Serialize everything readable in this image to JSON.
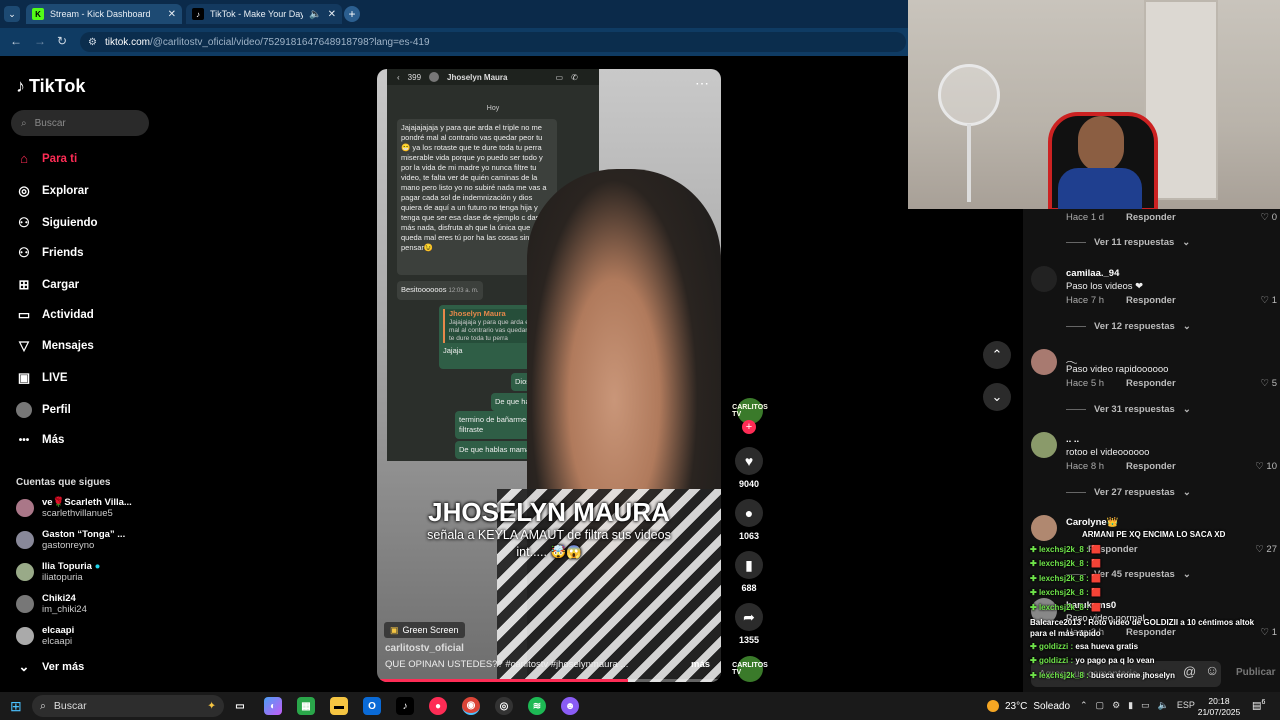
{
  "browser": {
    "tabs": [
      {
        "title": "Stream - Kick Dashboard",
        "favicon": "K"
      },
      {
        "title": "TikTok - Make Your Day",
        "favicon": "♪"
      }
    ],
    "url_host": "tiktok.com",
    "url_path": "/@carlitostv_oficial/video/7529181647648918798?lang=es-419"
  },
  "tiktok": {
    "logo": "TikTok",
    "search_placeholder": "Buscar",
    "nav": [
      {
        "label": "Para ti",
        "icon": "⌂"
      },
      {
        "label": "Explorar",
        "icon": "◎"
      },
      {
        "label": "Siguiendo",
        "icon": "⚇"
      },
      {
        "label": "Friends",
        "icon": "⚇"
      },
      {
        "label": "Cargar",
        "icon": "⊞"
      },
      {
        "label": "Actividad",
        "icon": "▭"
      },
      {
        "label": "Mensajes",
        "icon": "▽"
      },
      {
        "label": "LIVE",
        "icon": "▣"
      },
      {
        "label": "Perfil",
        "icon": ""
      },
      {
        "label": "Más",
        "icon": "•••"
      }
    ],
    "following_header": "Cuentas que sigues",
    "accounts": [
      {
        "name": "ve🌹Scarleth Villa...",
        "user": "scarlethvillanue5"
      },
      {
        "name": "Gaston “Tonga” ...",
        "user": "gastonreyno"
      },
      {
        "name": "Ilia Topuria",
        "user": "iliatopuria"
      },
      {
        "name": "Chiki24",
        "user": "im_chiki24"
      },
      {
        "name": "elcaapi",
        "user": "elcaapi"
      }
    ],
    "see_more": "Ver más"
  },
  "video": {
    "chat_back_count": "399",
    "chat_contact": "Jhoselyn Maura",
    "chat_day": "Hoy",
    "chat_msg_main": "Jajajajajaja y para que arda el triple no me pondré mal al contrario vas quedar peor tu 😁 ya los rotaste que te dure toda tu perra miserable vida porque yo puedo ser todo y por la vida de mi madre yo nunca filtre tu video, te falta ver de quién caminas de la mano pero listo yo no subiré nada me vas a pagar cada sol de indemnización y dios quiera de aquí a un futuro no tenga hija y tenga que ser esa clase de ejemplo c das tu, más nada, disfruta ah que la única que queda mal eres tú por ha las cosas sin pensar😉",
    "chat_msg_besito": "Besitoooooos",
    "chat_time": "12:03 a. m.",
    "chat_quote_name": "Jhoselyn Maura",
    "chat_quote_text": "Jajajajaja y para que arda el triple no me pondré mal al contrario vas quedar peor tu los rotaste que te dure toda tu perra",
    "chat_reply_1": "Jajaja",
    "chat_reply_2": "Dios mio",
    "chat_reply_3": "De que hablas",
    "chat_reply_4": "termino de bañarme y tu filtraste",
    "chat_reply_5": "De que hablas mama",
    "caption_big": "JHOSELYN MAURA",
    "caption_sub": "señala a KEYLA AMAUT de filtra sus videos int..... 🤯😱",
    "badge": "Green Screen",
    "username": "carlitostv_oficial",
    "description": "QUE OPINAN USTEDES?? #carlitostv #jhoselynmaura ...",
    "more": "más",
    "progress": 0.73,
    "likes": "9040",
    "comments": "1063",
    "saves": "688",
    "shares": "1355",
    "creator_badge": "CARLITOS TV"
  },
  "comments": [
    {
      "meta_time": "Hace 1 d",
      "reply": "Responder",
      "likes": "0",
      "replies": "Ver 11 respuestas"
    },
    {
      "user": "camilaa._94",
      "text": "Paso los videos ❤",
      "meta_time": "Hace 7 h",
      "reply": "Responder",
      "likes": "1",
      "replies": "Ver 12 respuestas"
    },
    {
      "user": "𓂃",
      "text": "Paso video rapidoooooo",
      "meta_time": "Hace 5 h",
      "reply": "Responder",
      "likes": "5",
      "replies": "Ver 31 respuestas"
    },
    {
      "user": ".. ..",
      "text": "rotoo el videoooooo",
      "meta_time": "Hace 8 h",
      "reply": "Responder",
      "likes": "10",
      "replies": "Ver 27 respuestas"
    },
    {
      "user": "Carolyne👑",
      "text": "",
      "meta_time": "",
      "reply": "Responder",
      "likes": "27",
      "replies": "Ver 45 respuestas"
    },
    {
      "user": "harukams0",
      "text": "Paso video normal",
      "meta_time": "Hace 2 h",
      "reply": "Responder",
      "likes": "1"
    }
  ],
  "comment_input_placeholder": "Agrega un comentario...",
  "publish": "Publicar",
  "stream_chat": [
    {
      "user": "",
      "msg": "ARMANI PE XQ ENCIMA LO SACA XD"
    },
    {
      "user": "lexchsj2k_8 :",
      "msg": "🟥"
    },
    {
      "user": "lexchsj2k_8 :",
      "msg": "🟥"
    },
    {
      "user": "lexchsj2k_8 :",
      "msg": "🟥"
    },
    {
      "user": "lexchsj2k_8 :",
      "msg": "🟥"
    },
    {
      "user": "lexchsj2k_8 :",
      "msg": "🟥"
    },
    {
      "user": "Balcarce2013 :",
      "msg": "Roto video de GOLDIZII a 10 céntimos altok"
    },
    {
      "user": "",
      "msg": "para el más rápido"
    },
    {
      "user": "goldizzi :",
      "msg": "esa hueva gratis"
    },
    {
      "user": "goldizzi :",
      "msg": "yo pago pa q lo vean"
    },
    {
      "user": "lexchsj2k_8 :",
      "msg": "busca erome jhoselyn"
    }
  ],
  "taskbar": {
    "search": "Buscar",
    "weather": "23°C",
    "weather_desc": "Soleado",
    "lang": "ESP",
    "time": "20:18",
    "date": "21/07/2025",
    "notif_count": "6"
  }
}
